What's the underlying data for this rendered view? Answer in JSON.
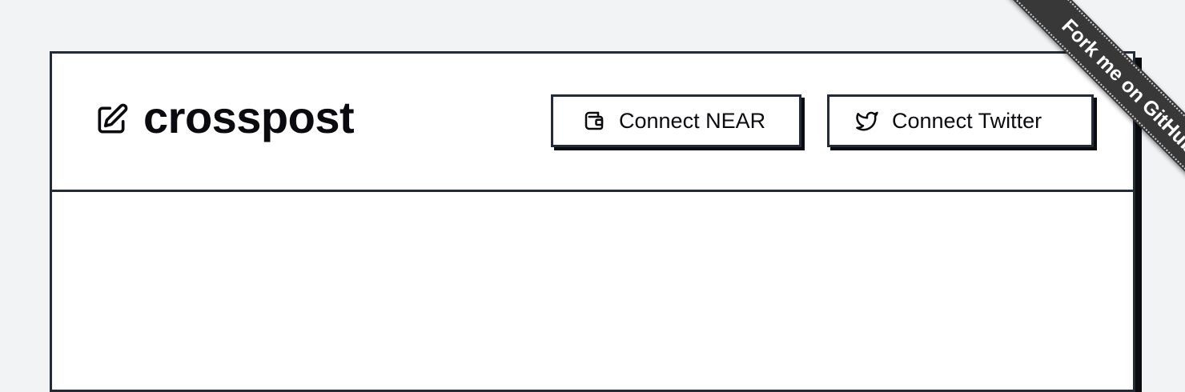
{
  "app": {
    "title": "crosspost",
    "icon": "edit-icon"
  },
  "header": {
    "connect_near_label": "Connect NEAR",
    "connect_near_icon": "wallet-icon",
    "connect_twitter_label": "Connect Twitter",
    "connect_twitter_icon": "twitter-icon"
  },
  "ribbon": {
    "label": "Fork me on GitHub",
    "color": "#383838"
  },
  "colors": {
    "background": "#f2f3f5",
    "card": "#ffffff",
    "border": "#232b38"
  }
}
